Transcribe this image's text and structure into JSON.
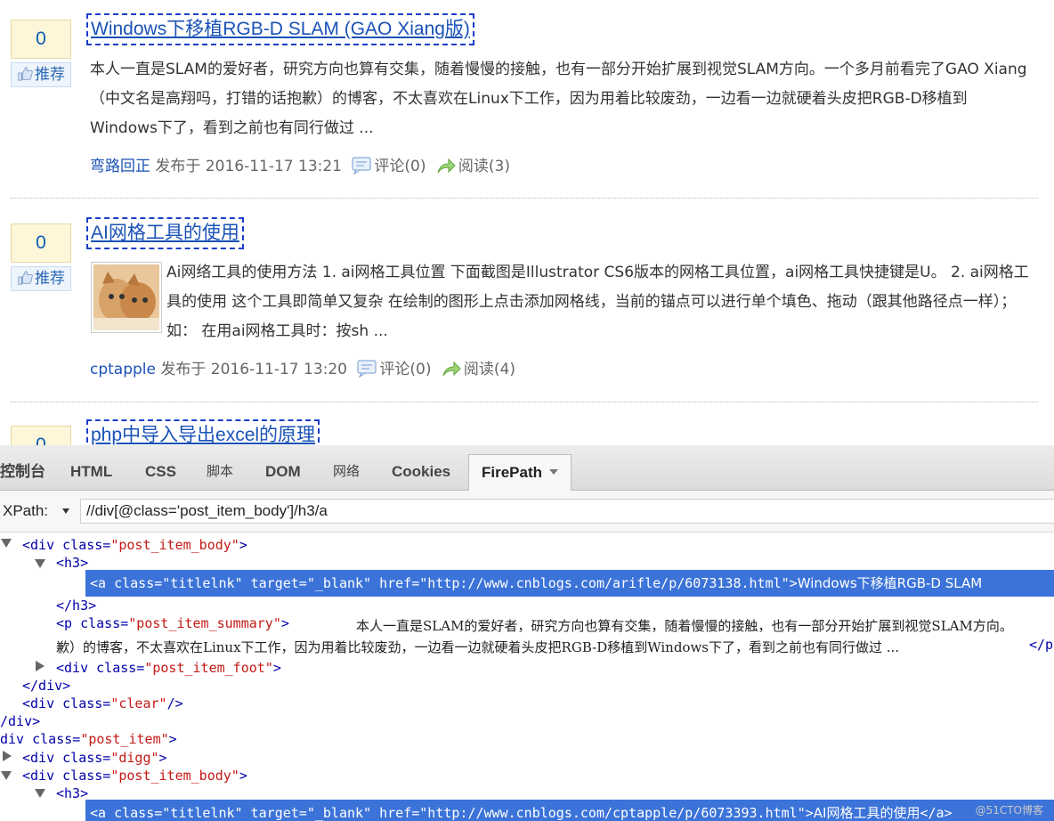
{
  "posts": [
    {
      "digg_count": "0",
      "digg_label": "推荐",
      "title": "Windows下移植RGB-D SLAM (GAO Xiang版)",
      "summary": "本人一直是SLAM的爱好者，研究方向也算有交集，随着慢慢的接触，也有一部分开始扩展到视觉SLAM方向。一个多月前看完了GAO Xiang（中文名是高翔吗，打错的话抱歉）的博客，不太喜欢在Linux下工作，因为用着比较废劲，一边看一边就硬着头皮把RGB-D移植到Windows下了，看到之前也有同行做过 ...",
      "author": "弯路回正",
      "published": "发布于 2016-11-17 13:21",
      "comments": "评论(0)",
      "reads": "阅读(3)"
    },
    {
      "digg_count": "0",
      "digg_label": "推荐",
      "title": "AI网格工具的使用",
      "summary": "Ai网络工具的使用方法 1. ai网格工具位置 下面截图是Illustrator CS6版本的网格工具位置，ai网格工具快捷键是U。 2. ai网格工具的使用 这个工具即简单又复杂 在绘制的图形上点击添加网格线，当前的锚点可以进行单个填色、拖动（跟其他路径点一样）； 如： 在用ai网格工具时：按sh ...",
      "author": "cptapple",
      "published": "发布于 2016-11-17 13:20",
      "comments": "评论(0)",
      "reads": "阅读(4)"
    },
    {
      "digg_count": "0",
      "title": "php中导入导出excel的原理"
    }
  ],
  "firebug": {
    "tabs": [
      "控制台",
      "HTML",
      "CSS",
      "脚本",
      "DOM",
      "网络",
      "Cookies",
      "FirePath"
    ],
    "active_tab": "FirePath",
    "xpath_label": "XPath:",
    "xpath_value": "//div[@class='post_item_body']/h3/a",
    "tree": {
      "l1_a": "<div ",
      "l1_attr": "class=",
      "l1_val": "\"post_item_body\"",
      "l1_b": ">",
      "l2": "<h3>",
      "l3_a": "<a ",
      "l3_rest": "class=\"titlelnk\" target=\"_blank\" href=\"http://www.cnblogs.com/arifle/p/6073138.html\">",
      "l3_text": "Windows下移植RGB-D SLAM",
      "l4": "</h3>",
      "l5_a": "<p ",
      "l5_attr": "class=",
      "l5_val": "\"post_item_summary\"",
      "l5_b": ">",
      "l5_text": "本人一直是SLAM的爱好者，研究方向也算有交集，随着慢慢的接触，也有一部分开始扩展到视觉SLAM方向。",
      "l6_text": "歉）的博客，不太喜欢在Linux下工作，因为用着比较废劲，一边看一边就硬着头皮把RGB-D移植到Windows下了，看到之前也有同行做过 ...",
      "l6_end": "</p",
      "l7_a": "<div ",
      "l7_attr": "class=",
      "l7_val": "\"post_item_foot\"",
      "l7_b": ">",
      "l8": "</div>",
      "l9_a": "<div ",
      "l9_attr": "class=",
      "l9_val": "\"clear\"",
      "l9_b": "/>",
      "l10": "/div>",
      "l11_a": "div ",
      "l11_attr": "class=",
      "l11_val": "\"post_item\"",
      "l11_b": ">",
      "l12_a": "<div ",
      "l12_attr": "class=",
      "l12_val": "\"digg\"",
      "l12_b": ">",
      "l13_a": "<div ",
      "l13_attr": "class=",
      "l13_val": "\"post_item_body\"",
      "l13_b": ">",
      "l14": "<h3>",
      "l15_a": "<a ",
      "l15_rest": "class=\"titlelnk\" target=\"_blank\" href=\"http://www.cnblogs.com/cptapple/p/6073393.html\">",
      "l15_text": "AI网格工具的使用",
      "l15_end": "</a>"
    }
  },
  "watermark": "@51CTO博客",
  "colors": {
    "link": "#1a52b7",
    "highlight": "#3b73d9",
    "attr_value": "#c41a16"
  }
}
